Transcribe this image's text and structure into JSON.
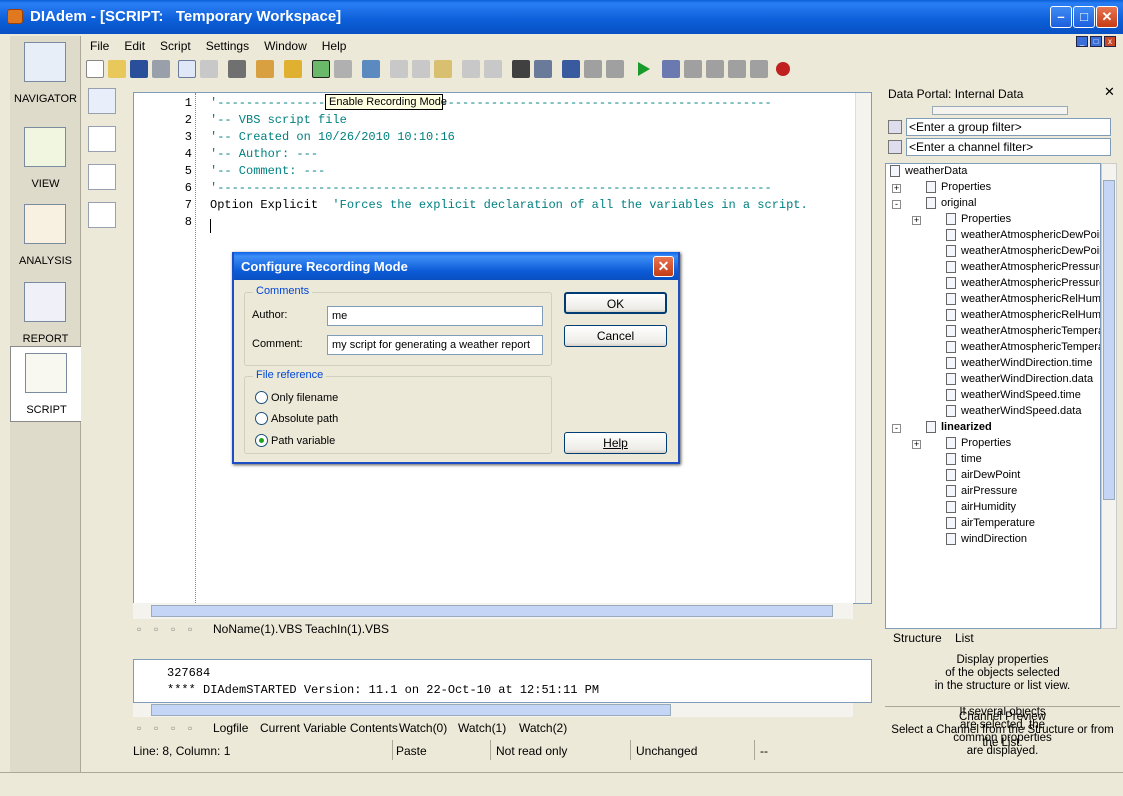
{
  "window": {
    "title": "DIAdem - [SCRIPT:   Temporary Workspace]"
  },
  "menu": [
    "File",
    "Edit",
    "Script",
    "Settings",
    "Window",
    "Help"
  ],
  "nav": [
    {
      "label": "NAVIGATOR",
      "icon": "navigator-icon"
    },
    {
      "label": "VIEW",
      "icon": "view-icon"
    },
    {
      "label": "ANALYSIS",
      "icon": "analysis-icon"
    },
    {
      "label": "REPORT",
      "icon": "report-icon"
    },
    {
      "label": "SCRIPT",
      "icon": "script-icon"
    }
  ],
  "tooltip": "Enable Recording Mode",
  "editor": {
    "line_numbers": [
      "1",
      "2",
      "3",
      "4",
      "5",
      "6",
      "7",
      "8"
    ],
    "lines": [
      {
        "text": "'-----------------------------------------------------------------------------",
        "cls": "cmt"
      },
      {
        "text": "'-- VBS script file",
        "cls": "cmt"
      },
      {
        "text": "'-- Created on 10/26/2010 10:10:16",
        "cls": "cmt"
      },
      {
        "text": "'-- Author: ---",
        "cls": "cmt"
      },
      {
        "text": "'-- Comment: ---",
        "cls": "cmt"
      },
      {
        "text": "'-----------------------------------------------------------------------------",
        "cls": "cmt"
      },
      {
        "text": "Option Explicit",
        "cls": "kw",
        "trail": "  'Forces the explicit declaration of all the variables in a script."
      },
      {
        "text": "",
        "cls": "kw"
      }
    ],
    "tabs": [
      "NoName(1).VBS",
      "TeachIn(1).VBS"
    ]
  },
  "log": {
    "lines": [
      "327684",
      "**** DIAdemSTARTED Version: 11.1 on 22-Oct-10 at 12:51:11 PM"
    ],
    "tabs": [
      "Logfile",
      "Current Variable Contents",
      "Watch(0)",
      "Watch(1)",
      "Watch(2)"
    ]
  },
  "status": {
    "position": "Line: 8, Column: 1",
    "mode": "Paste",
    "access": "Not read only",
    "state": "Unchanged",
    "extra": "--"
  },
  "portal": {
    "title": "Data Portal: Internal Data",
    "group_filter_placeholder": "<Enter a group filter>",
    "channel_filter_placeholder": "<Enter a channel filter>",
    "tree": [
      {
        "label": "weatherData",
        "level": 0,
        "bold": false
      },
      {
        "label": "Properties",
        "level": 1,
        "exp": "+"
      },
      {
        "label": "original",
        "level": 1,
        "exp": "-"
      },
      {
        "label": "Properties",
        "level": 2,
        "exp": "+"
      },
      {
        "label": "weatherAtmosphericDewPoint.time",
        "level": 3
      },
      {
        "label": "weatherAtmosphericDewPoint.data",
        "level": 3
      },
      {
        "label": "weatherAtmosphericPressure.time",
        "level": 3
      },
      {
        "label": "weatherAtmosphericPressure.data",
        "level": 3
      },
      {
        "label": "weatherAtmosphericRelHumidity.time",
        "level": 3
      },
      {
        "label": "weatherAtmosphericRelHumidity.data",
        "level": 3
      },
      {
        "label": "weatherAtmosphericTemperature.time",
        "level": 3
      },
      {
        "label": "weatherAtmosphericTemperature.data",
        "level": 3
      },
      {
        "label": "weatherWindDirection.time",
        "level": 3
      },
      {
        "label": "weatherWindDirection.data",
        "level": 3
      },
      {
        "label": "weatherWindSpeed.time",
        "level": 3
      },
      {
        "label": "weatherWindSpeed.data",
        "level": 3
      },
      {
        "label": "linearized",
        "level": 1,
        "exp": "-",
        "bold": true
      },
      {
        "label": "Properties",
        "level": 2,
        "exp": "+"
      },
      {
        "label": "time",
        "level": 3
      },
      {
        "label": "airDewPoint",
        "level": 3
      },
      {
        "label": "airPressure",
        "level": 3
      },
      {
        "label": "airHumidity",
        "level": 3
      },
      {
        "label": "airTemperature",
        "level": 3
      },
      {
        "label": "windDirection",
        "level": 3
      }
    ],
    "tabs": [
      "Structure",
      "List"
    ],
    "info": [
      "Display properties",
      "of the objects selected",
      "in the structure or list view.",
      "",
      "If several objects",
      "are selected, the",
      "common properties",
      "are displayed."
    ],
    "preview_title": "Channel Preview",
    "preview_text": "Select a Channel from the Structure or from the List."
  },
  "dialog": {
    "title": "Configure Recording Mode",
    "comments_group": "Comments",
    "author_label": "Author:",
    "author_value": "me",
    "comment_label": "Comment:",
    "comment_value": "my script for generating a weather report",
    "file_group": "File reference",
    "options": [
      "Only filename",
      "Absolute path",
      "Path variable"
    ],
    "selected": 2,
    "ok": "OK",
    "cancel": "Cancel",
    "help": "Help"
  }
}
